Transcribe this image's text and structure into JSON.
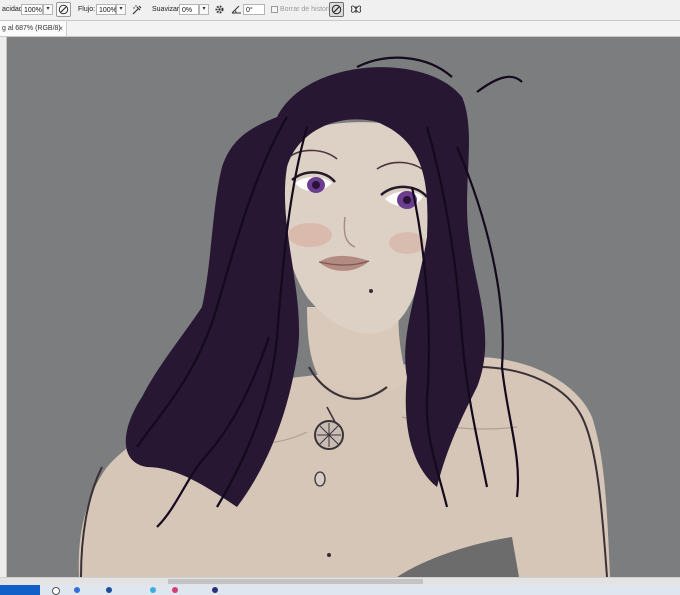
{
  "options_bar": {
    "opacity_label": "acidad:",
    "opacity_value": "100%",
    "flow_label": "Flujo:",
    "flow_value": "100%",
    "smoothing_label": "Suavizar:",
    "smoothing_value": "0%",
    "angle_value": "0°",
    "erase_history_label": "Borrar de historia"
  },
  "document_tab": {
    "title": "g al 687% (RGB/8)",
    "close_glyph": "×"
  },
  "icons": {
    "pressure_opacity": "pen-pressure-icon",
    "airbrush": "airbrush-icon",
    "settings": "gear-icon",
    "angle": "angle-icon",
    "pressure_size": "pen-pressure-size-icon",
    "symmetry": "butterfly-icon",
    "dropdown": "▾"
  },
  "colors": {
    "canvas_bg": "#7b7c7d",
    "hair": "#2a1a3a",
    "skin": "#d4c4b6",
    "taskbar_start": "#1060c8"
  }
}
